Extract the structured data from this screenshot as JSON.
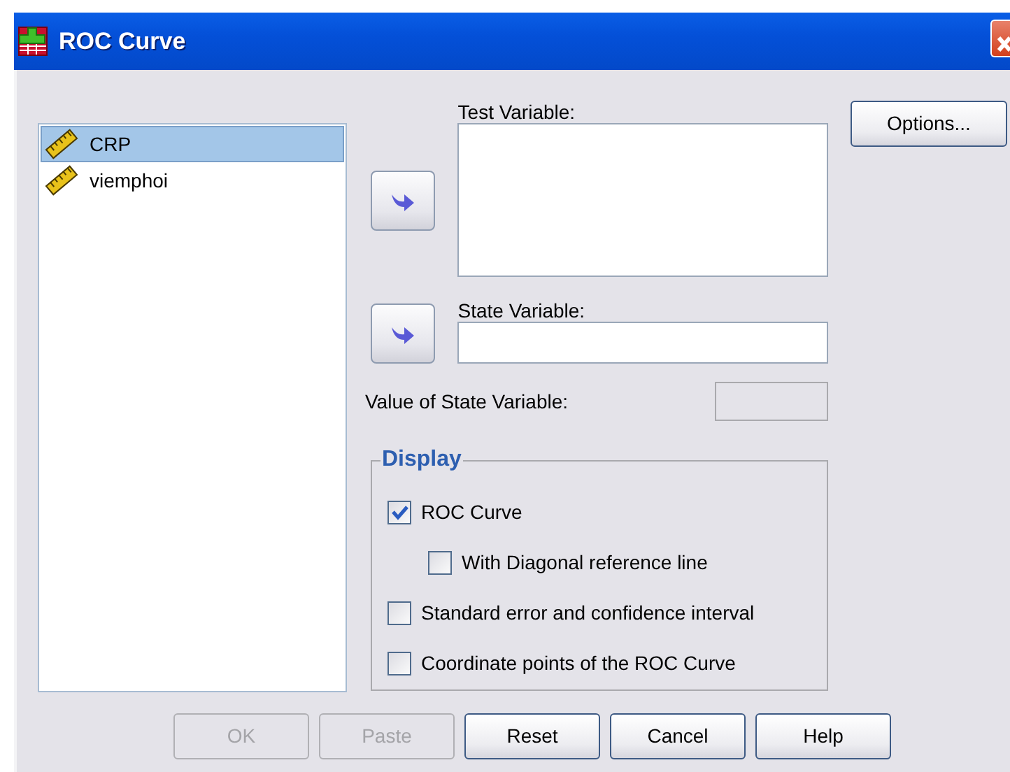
{
  "window": {
    "title": "ROC Curve"
  },
  "variables": [
    {
      "label": "CRP",
      "selected": true
    },
    {
      "label": "viemphoi",
      "selected": false
    }
  ],
  "test_variable": {
    "label": "Test Variable:"
  },
  "state_variable": {
    "label": "State Variable:"
  },
  "value_of_state_variable": {
    "label": "Value of State Variable:",
    "disabled": true
  },
  "options_button": {
    "label": "Options..."
  },
  "display": {
    "title": "Display",
    "options": [
      {
        "label": "ROC Curve",
        "checked": true,
        "children": [
          {
            "label": "With Diagonal reference line",
            "checked": false
          }
        ]
      },
      {
        "label": "Standard error and confidence interval",
        "checked": false
      },
      {
        "label": "Coordinate points of the ROC Curve",
        "checked": false
      }
    ]
  },
  "buttons": [
    {
      "label": "OK",
      "disabled": true
    },
    {
      "label": "Paste",
      "disabled": true
    },
    {
      "label": "Reset",
      "disabled": false
    },
    {
      "label": "Cancel",
      "disabled": false
    },
    {
      "label": "Help",
      "disabled": false
    }
  ]
}
